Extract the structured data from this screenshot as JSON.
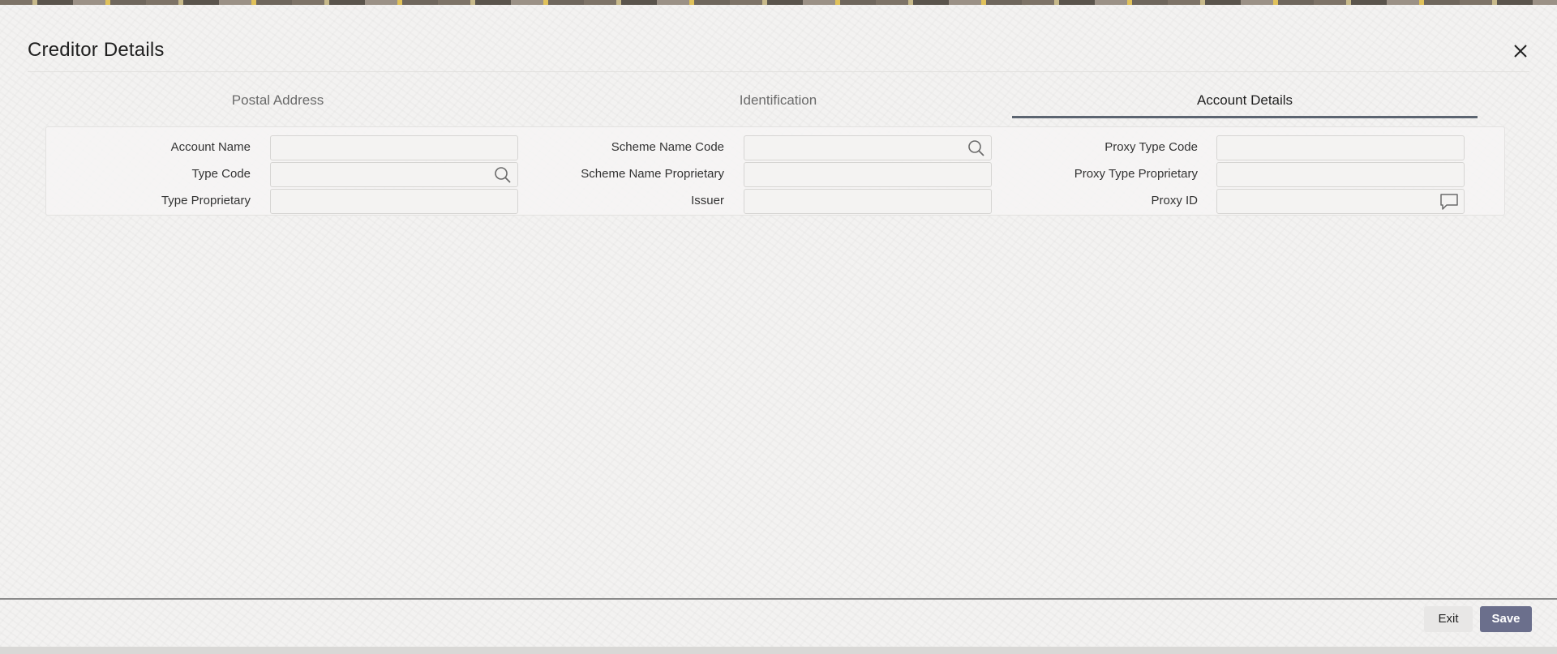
{
  "dialog": {
    "title": "Creditor Details",
    "close_icon": "close-icon"
  },
  "tabs": [
    {
      "label": "Postal Address",
      "active": false
    },
    {
      "label": "Identification",
      "active": false
    },
    {
      "label": "Account Details",
      "active": true
    }
  ],
  "form": {
    "col1": [
      {
        "label": "Account Name",
        "value": "",
        "icon": null
      },
      {
        "label": "Type Code",
        "value": "",
        "icon": "search-icon"
      },
      {
        "label": "Type Proprietary",
        "value": "",
        "icon": null
      }
    ],
    "col2": [
      {
        "label": "Scheme Name Code",
        "value": "",
        "icon": "search-icon"
      },
      {
        "label": "Scheme Name Proprietary",
        "value": "",
        "icon": null
      },
      {
        "label": "Issuer",
        "value": "",
        "icon": null
      }
    ],
    "col3": [
      {
        "label": "Proxy Type Code",
        "value": "",
        "icon": null
      },
      {
        "label": "Proxy Type Proprietary",
        "value": "",
        "icon": null
      },
      {
        "label": "Proxy ID",
        "value": "",
        "icon": "comment-icon"
      }
    ]
  },
  "footer": {
    "exit_label": "Exit",
    "save_label": "Save"
  },
  "colors": {
    "active_tab_underline": "#5b6470",
    "save_button": "#6b6f8c"
  }
}
